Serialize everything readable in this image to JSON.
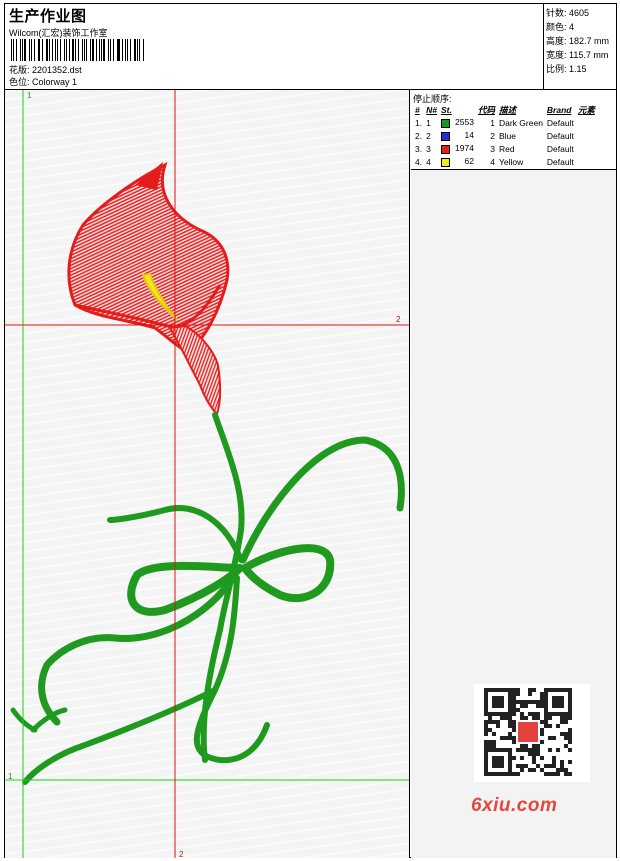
{
  "header": {
    "title": "生产作业图",
    "company": "Wilcom(汇宏)装饰工作室",
    "design_label": "花版:",
    "design_value": "2201352.dst",
    "colorway_label": "色位:",
    "colorway_value": "Colorway 1"
  },
  "stats": [
    {
      "label": "针数:",
      "value": "4605"
    },
    {
      "label": "颜色:",
      "value": "4"
    },
    {
      "label": "高度:",
      "value": "182.7 mm"
    },
    {
      "label": "宽度:",
      "value": "115.7 mm"
    },
    {
      "label": "比例:",
      "value": "1.15"
    }
  ],
  "stop_sequence": {
    "title": "停止顺序:",
    "columns": [
      "#",
      "N#",
      "St.",
      "代码",
      "描述",
      "Brand",
      "元素"
    ],
    "rows": [
      {
        "idx": "1.",
        "n": "1",
        "color": "#1a9a1a",
        "stitches": "2553",
        "code": "1",
        "desc": "Dark Green",
        "brand": "Default"
      },
      {
        "idx": "2.",
        "n": "2",
        "color": "#1f2fd6",
        "stitches": "14",
        "code": "2",
        "desc": "Blue",
        "brand": "Default"
      },
      {
        "idx": "3.",
        "n": "3",
        "color": "#e3201e",
        "stitches": "1974",
        "code": "3",
        "desc": "Red",
        "brand": "Default"
      },
      {
        "idx": "4.",
        "n": "4",
        "color": "#f2ee16",
        "stitches": "62",
        "code": "4",
        "desc": "Yellow",
        "brand": "Default"
      }
    ]
  },
  "guides": {
    "green_v": "1",
    "green_h": "1",
    "red_h": "2",
    "red_v": "2"
  },
  "colors": {
    "red_thread": "#e41c1c",
    "green_thread": "#1f9a1f",
    "yellow_thread": "#f3e81a",
    "guide_red": "#e01010",
    "guide_green": "#16d016"
  },
  "watermark": "6xiu.com"
}
